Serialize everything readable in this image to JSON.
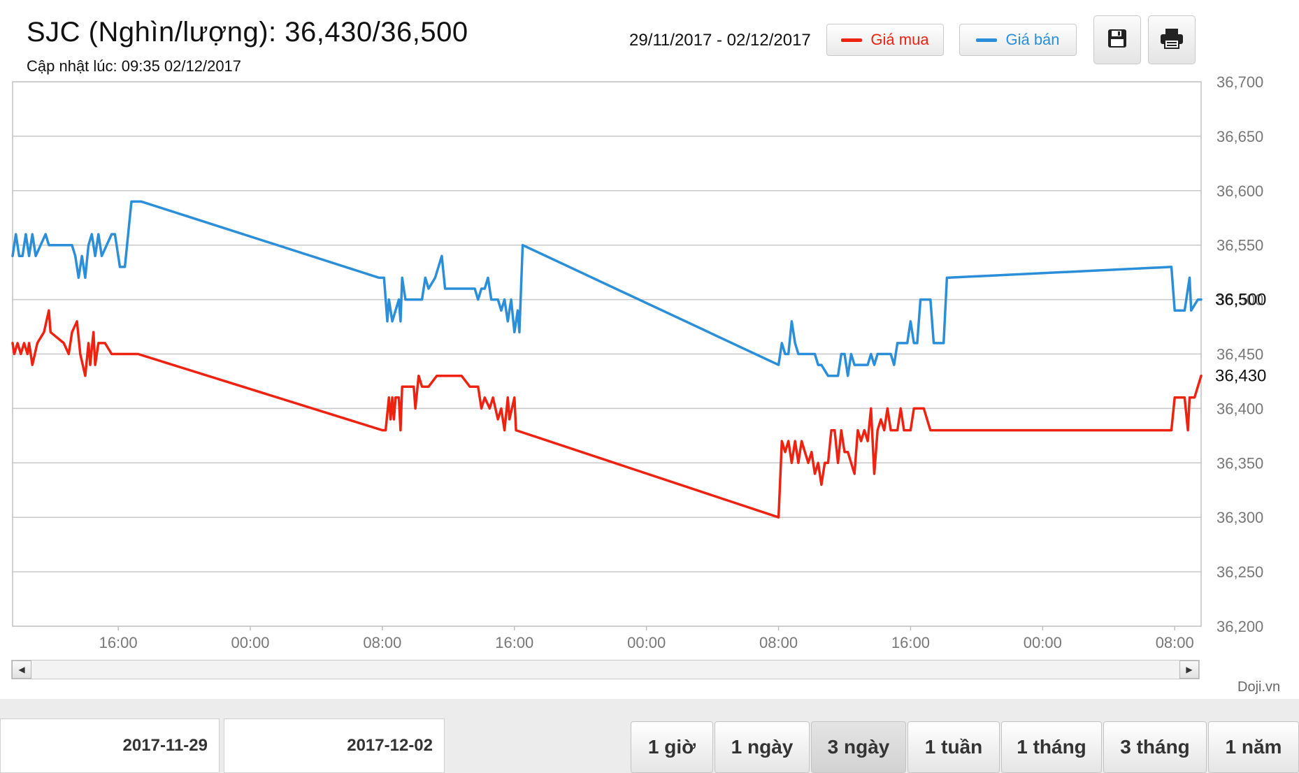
{
  "header": {
    "title": "SJC (Nghìn/lượng): 36,430/36,500",
    "updated": "Cập nhật lúc: 09:35 02/12/2017",
    "range": "29/11/2017 - 02/12/2017"
  },
  "legend": [
    {
      "label": "Giá mua",
      "color": "#ee2211"
    },
    {
      "label": "Giá bán",
      "color": "#2a8fd8"
    }
  ],
  "toolbar": {
    "save_icon": "save-icon",
    "print_icon": "print-icon"
  },
  "credit": "Doji.vn",
  "date_inputs": {
    "from": "2017-11-29",
    "to": "2017-12-02"
  },
  "range_buttons": [
    "1 giờ",
    "1 ngày",
    "3 ngày",
    "1 tuần",
    "1 tháng",
    "3 tháng",
    "1 năm"
  ],
  "active_range": "3 ngày",
  "chart_data": {
    "type": "line",
    "ylim": [
      36200,
      36700
    ],
    "y_ticks": [
      36200,
      36250,
      36300,
      36350,
      36400,
      36450,
      36500,
      36550,
      36600,
      36650,
      36700
    ],
    "y_tick_labels": [
      "36,200",
      "36,250",
      "36,300",
      "36,350",
      "36,400",
      "36,450",
      "36,500",
      "36,550",
      "36,600",
      "36,650",
      "36,700"
    ],
    "x_unit": "hours since 2017-11-29 00:00",
    "xlim": [
      9.6,
      81.6
    ],
    "x_ticks": [
      16,
      24,
      32,
      40,
      48,
      56,
      64,
      72,
      80
    ],
    "x_tick_labels": [
      "16:00",
      "00:00",
      "08:00",
      "16:00",
      "00:00",
      "08:00",
      "16:00",
      "00:00",
      "08:00"
    ],
    "current_labels": [
      {
        "label": "36,500",
        "value": 36500
      },
      {
        "label": "36,430",
        "value": 36430
      }
    ],
    "grid": true,
    "series": [
      {
        "name": "Giá mua",
        "color": "#ee2211",
        "points": [
          [
            9.6,
            36460
          ],
          [
            9.7,
            36450
          ],
          [
            9.9,
            36460
          ],
          [
            10.1,
            36450
          ],
          [
            10.3,
            36460
          ],
          [
            10.5,
            36450
          ],
          [
            10.6,
            36460
          ],
          [
            10.8,
            36440
          ],
          [
            11.1,
            36460
          ],
          [
            11.5,
            36470
          ],
          [
            11.8,
            36490
          ],
          [
            11.9,
            36470
          ],
          [
            12.3,
            36465
          ],
          [
            12.7,
            36460
          ],
          [
            13.0,
            36450
          ],
          [
            13.2,
            36470
          ],
          [
            13.5,
            36480
          ],
          [
            13.7,
            36450
          ],
          [
            14.0,
            36430
          ],
          [
            14.2,
            36460
          ],
          [
            14.3,
            36440
          ],
          [
            14.5,
            36470
          ],
          [
            14.6,
            36440
          ],
          [
            14.8,
            36460
          ],
          [
            15.2,
            36460
          ],
          [
            15.6,
            36450
          ],
          [
            16.4,
            36450
          ],
          [
            17.2,
            36450
          ],
          [
            32.0,
            36380
          ],
          [
            32.2,
            36380
          ],
          [
            32.4,
            36410
          ],
          [
            32.5,
            36390
          ],
          [
            32.6,
            36410
          ],
          [
            32.7,
            36390
          ],
          [
            32.8,
            36410
          ],
          [
            33.0,
            36410
          ],
          [
            33.1,
            36380
          ],
          [
            33.2,
            36420
          ],
          [
            33.4,
            36420
          ],
          [
            33.9,
            36420
          ],
          [
            34.0,
            36400
          ],
          [
            34.2,
            36430
          ],
          [
            34.4,
            36420
          ],
          [
            34.8,
            36420
          ],
          [
            35.3,
            36430
          ],
          [
            36.8,
            36430
          ],
          [
            37.3,
            36420
          ],
          [
            37.8,
            36420
          ],
          [
            38.0,
            36400
          ],
          [
            38.2,
            36410
          ],
          [
            38.5,
            36400
          ],
          [
            38.7,
            36410
          ],
          [
            39.0,
            36390
          ],
          [
            39.2,
            36400
          ],
          [
            39.4,
            36380
          ],
          [
            39.6,
            36410
          ],
          [
            39.7,
            36390
          ],
          [
            40.0,
            36410
          ],
          [
            40.1,
            36380
          ],
          [
            56.0,
            36300
          ],
          [
            56.2,
            36370
          ],
          [
            56.4,
            36360
          ],
          [
            56.6,
            36370
          ],
          [
            56.8,
            36350
          ],
          [
            57.0,
            36370
          ],
          [
            57.2,
            36350
          ],
          [
            57.4,
            36370
          ],
          [
            57.6,
            36360
          ],
          [
            57.8,
            36350
          ],
          [
            58.0,
            36360
          ],
          [
            58.2,
            36340
          ],
          [
            58.4,
            36350
          ],
          [
            58.6,
            36330
          ],
          [
            58.8,
            36350
          ],
          [
            59.0,
            36350
          ],
          [
            59.2,
            36380
          ],
          [
            59.4,
            36380
          ],
          [
            59.6,
            36350
          ],
          [
            59.8,
            36380
          ],
          [
            60.0,
            36360
          ],
          [
            60.2,
            36360
          ],
          [
            60.4,
            36350
          ],
          [
            60.6,
            36340
          ],
          [
            60.8,
            36380
          ],
          [
            61.0,
            36370
          ],
          [
            61.2,
            36380
          ],
          [
            61.4,
            36370
          ],
          [
            61.6,
            36400
          ],
          [
            61.8,
            36340
          ],
          [
            62.0,
            36380
          ],
          [
            62.2,
            36390
          ],
          [
            62.4,
            36380
          ],
          [
            62.6,
            36400
          ],
          [
            62.8,
            36380
          ],
          [
            63.2,
            36380
          ],
          [
            63.4,
            36400
          ],
          [
            63.6,
            36380
          ],
          [
            64.0,
            36380
          ],
          [
            64.2,
            36400
          ],
          [
            64.5,
            36400
          ],
          [
            64.8,
            36400
          ],
          [
            65.2,
            36380
          ],
          [
            65.8,
            36380
          ],
          [
            79.8,
            36380
          ],
          [
            80.0,
            36410
          ],
          [
            80.6,
            36410
          ],
          [
            80.8,
            36380
          ],
          [
            80.9,
            36410
          ],
          [
            81.2,
            36410
          ],
          [
            81.6,
            36430
          ]
        ]
      },
      {
        "name": "Giá bán",
        "color": "#2a8fd8",
        "points": [
          [
            9.6,
            36540
          ],
          [
            9.8,
            36560
          ],
          [
            10.0,
            36540
          ],
          [
            10.2,
            36540
          ],
          [
            10.4,
            36560
          ],
          [
            10.6,
            36540
          ],
          [
            10.8,
            36560
          ],
          [
            11.0,
            36540
          ],
          [
            11.3,
            36550
          ],
          [
            11.6,
            36560
          ],
          [
            11.8,
            36550
          ],
          [
            12.2,
            36550
          ],
          [
            12.8,
            36550
          ],
          [
            13.2,
            36550
          ],
          [
            13.4,
            36540
          ],
          [
            13.6,
            36520
          ],
          [
            13.8,
            36540
          ],
          [
            14.0,
            36520
          ],
          [
            14.2,
            36550
          ],
          [
            14.4,
            36560
          ],
          [
            14.6,
            36540
          ],
          [
            14.8,
            36560
          ],
          [
            15.0,
            36540
          ],
          [
            15.6,
            36560
          ],
          [
            15.8,
            36560
          ],
          [
            16.1,
            36530
          ],
          [
            16.4,
            36530
          ],
          [
            16.8,
            36590
          ],
          [
            17.4,
            36590
          ],
          [
            31.8,
            36520
          ],
          [
            32.1,
            36520
          ],
          [
            32.3,
            36480
          ],
          [
            32.4,
            36500
          ],
          [
            32.6,
            36480
          ],
          [
            32.8,
            36490
          ],
          [
            33.0,
            36500
          ],
          [
            33.1,
            36480
          ],
          [
            33.2,
            36520
          ],
          [
            33.4,
            36500
          ],
          [
            34.0,
            36500
          ],
          [
            34.4,
            36500
          ],
          [
            34.6,
            36520
          ],
          [
            34.8,
            36510
          ],
          [
            35.2,
            36520
          ],
          [
            35.6,
            36540
          ],
          [
            35.8,
            36510
          ],
          [
            36.4,
            36510
          ],
          [
            37.2,
            36510
          ],
          [
            37.6,
            36510
          ],
          [
            37.8,
            36500
          ],
          [
            38.0,
            36510
          ],
          [
            38.2,
            36510
          ],
          [
            38.4,
            36520
          ],
          [
            38.6,
            36500
          ],
          [
            38.8,
            36500
          ],
          [
            39.0,
            36500
          ],
          [
            39.2,
            36490
          ],
          [
            39.4,
            36500
          ],
          [
            39.6,
            36480
          ],
          [
            39.8,
            36500
          ],
          [
            40.0,
            36470
          ],
          [
            40.2,
            36490
          ],
          [
            40.3,
            36470
          ],
          [
            40.5,
            36550
          ],
          [
            56.0,
            36440
          ],
          [
            56.2,
            36460
          ],
          [
            56.4,
            36450
          ],
          [
            56.6,
            36450
          ],
          [
            56.8,
            36480
          ],
          [
            57.0,
            36460
          ],
          [
            57.2,
            36450
          ],
          [
            58.2,
            36450
          ],
          [
            58.4,
            36440
          ],
          [
            58.6,
            36440
          ],
          [
            59.0,
            36430
          ],
          [
            59.6,
            36430
          ],
          [
            59.8,
            36450
          ],
          [
            60.0,
            36450
          ],
          [
            60.2,
            36430
          ],
          [
            60.4,
            36450
          ],
          [
            60.6,
            36440
          ],
          [
            61.0,
            36440
          ],
          [
            61.4,
            36440
          ],
          [
            61.6,
            36450
          ],
          [
            61.8,
            36440
          ],
          [
            62.0,
            36450
          ],
          [
            62.2,
            36450
          ],
          [
            62.8,
            36450
          ],
          [
            63.0,
            36440
          ],
          [
            63.2,
            36460
          ],
          [
            63.4,
            36460
          ],
          [
            63.8,
            36460
          ],
          [
            64.0,
            36480
          ],
          [
            64.2,
            36460
          ],
          [
            64.4,
            36460
          ],
          [
            64.6,
            36500
          ],
          [
            65.2,
            36500
          ],
          [
            65.4,
            36460
          ],
          [
            65.8,
            36460
          ],
          [
            66.0,
            36460
          ],
          [
            66.2,
            36520
          ],
          [
            79.8,
            36530
          ],
          [
            80.0,
            36490
          ],
          [
            80.6,
            36490
          ],
          [
            80.9,
            36520
          ],
          [
            81.0,
            36490
          ],
          [
            81.4,
            36500
          ],
          [
            81.6,
            36500
          ]
        ]
      }
    ]
  }
}
